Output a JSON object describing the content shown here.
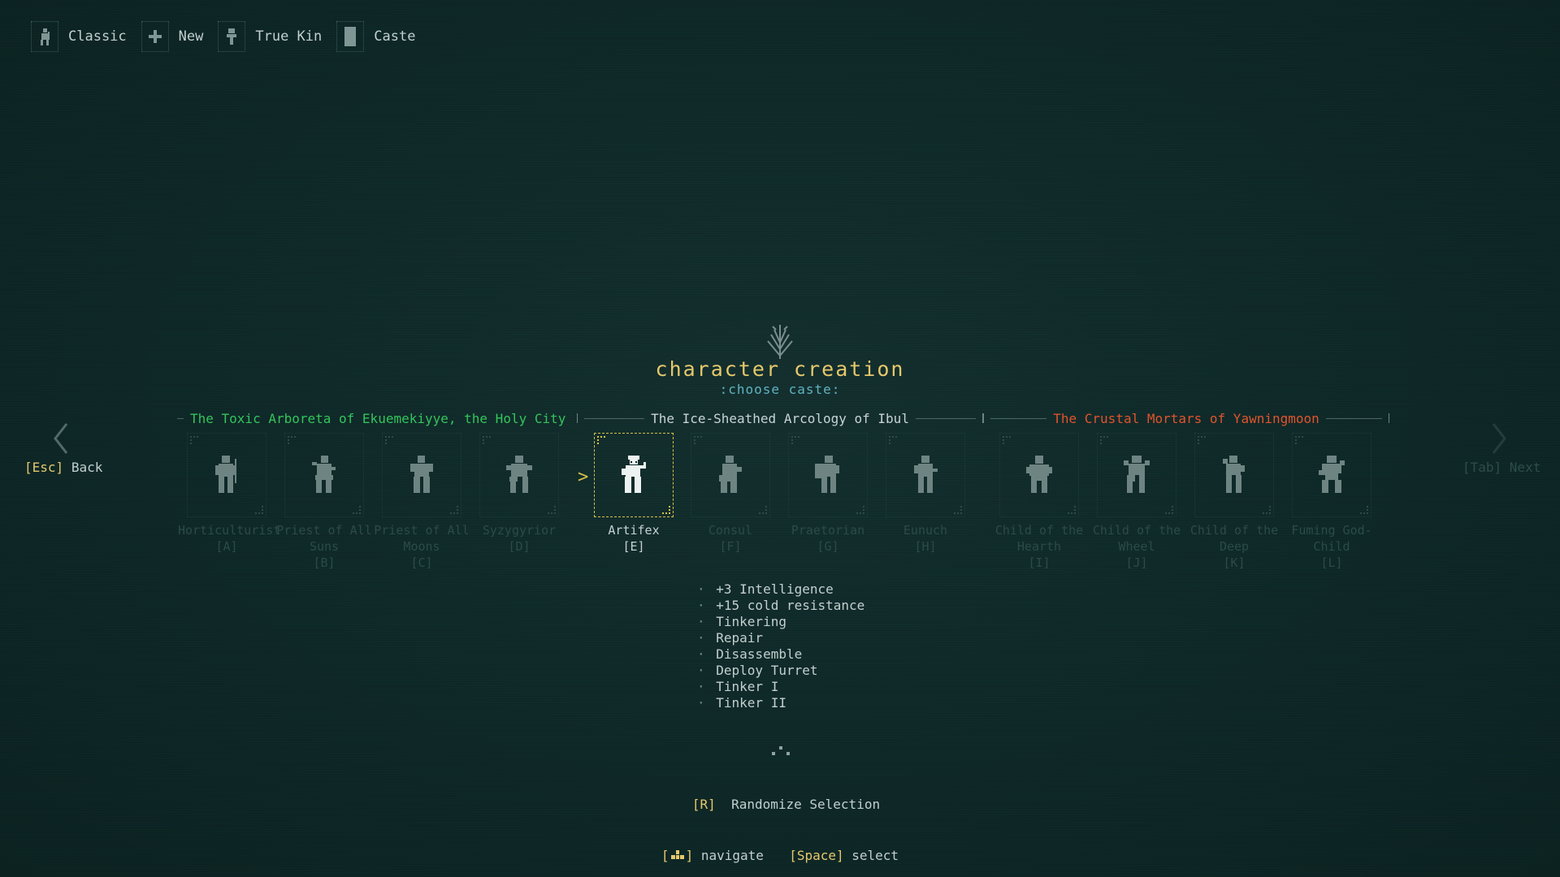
{
  "breadcrumb": [
    {
      "label": "Classic",
      "icon": "classic-figure-icon"
    },
    {
      "label": "New",
      "icon": "plus-icon"
    },
    {
      "label": "True Kin",
      "icon": "true-kin-icon"
    },
    {
      "label": "Caste",
      "icon": "caste-card-icon"
    }
  ],
  "header": {
    "title": "character creation",
    "subtitle": ":choose caste:"
  },
  "factions": [
    {
      "name": "The Toxic Arboreta of Ekuemekiyye, the Holy City",
      "color": "#34c45a"
    },
    {
      "name": "The Ice-Sheathed Arcology of Ibul",
      "color": "#c7d4d4"
    },
    {
      "name": "The Crustal Mortars of Yawningmoon",
      "color": "#e0542c"
    }
  ],
  "nav": {
    "back_key": "[Esc]",
    "back_label": "Back",
    "next_label": "[Tab] Next"
  },
  "castes": [
    {
      "name": "Horticulturist",
      "hotkey": "[A]"
    },
    {
      "name": "Priest of All Suns",
      "hotkey": "[B]"
    },
    {
      "name": "Priest of All Moons",
      "hotkey": "[C]"
    },
    {
      "name": "Syzygyrior",
      "hotkey": "[D]"
    },
    {
      "name": "Artifex",
      "hotkey": "[E]",
      "selected": true
    },
    {
      "name": "Consul",
      "hotkey": "[F]"
    },
    {
      "name": "Praetorian",
      "hotkey": "[G]"
    },
    {
      "name": "Eunuch",
      "hotkey": "[H]"
    },
    {
      "name": "Child of the Hearth",
      "hotkey": "[I]"
    },
    {
      "name": "Child of the Wheel",
      "hotkey": "[J]"
    },
    {
      "name": "Child of the Deep",
      "hotkey": "[K]"
    },
    {
      "name": "Fuming God-Child",
      "hotkey": "[L]"
    }
  ],
  "selected_caste_bonuses": [
    "+3 Intelligence",
    "+15 cold resistance",
    "Tinkering",
    "Repair",
    "Disassemble",
    "Deploy Turret",
    "Tinker I",
    "Tinker II"
  ],
  "randomize": {
    "key": "[R]",
    "label": "Randomize Selection"
  },
  "footer": {
    "navigate_label": "navigate",
    "select_key": "[Space]",
    "select_label": "select"
  },
  "colors": {
    "accent": "#e5c86b",
    "subtitle": "#5fb3c1",
    "background": "#0f2a2a"
  }
}
